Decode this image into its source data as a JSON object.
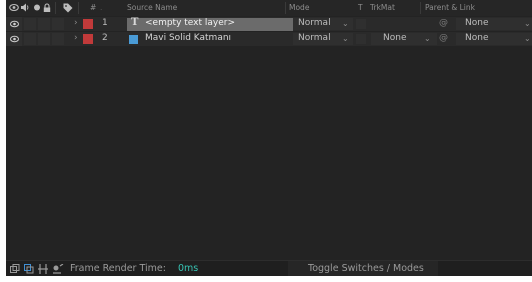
{
  "header": {
    "hash": "#",
    "source_name": "Source Name",
    "mode": "Mode",
    "t": "T",
    "trkmat": "TrkMat",
    "parent_link": "Parent & Link"
  },
  "layers": [
    {
      "number": "1",
      "type_icon": "text-layer-icon",
      "type_glyph": "T",
      "name": "<empty text layer>",
      "selected": true,
      "label_color": "#c13a3a",
      "mode": "Normal",
      "trkmat": "",
      "parent": "None"
    },
    {
      "number": "2",
      "type_icon": "solid-layer-icon",
      "name": "Mavi Solid Katmanı",
      "selected": false,
      "label_color": "#c13a3a",
      "solid_color": "#4a9bd6",
      "mode": "Normal",
      "trkmat": "None",
      "parent": "None"
    }
  ],
  "footer": {
    "frame_render_label": "Frame Render Time:",
    "frame_render_value": "0ms",
    "toggle_label": "Toggle Switches / Modes",
    "accent_color": "#37c3b3"
  }
}
